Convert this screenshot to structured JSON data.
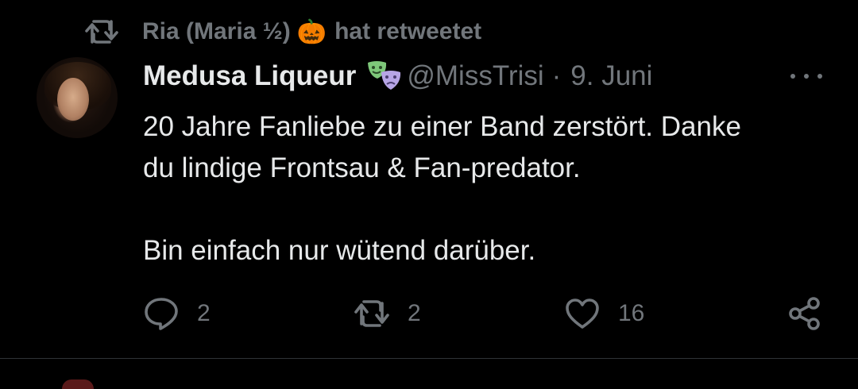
{
  "social_context": {
    "retweeter": "Ria (Maria ½)",
    "emoji": "🎃",
    "action": "hat retweetet"
  },
  "tweet": {
    "author_name": "Medusa Liqueur",
    "author_handle": "@MissTrisi",
    "separator": "·",
    "date": "9. Juni",
    "text": "20 Jahre Fanliebe zu einer Band zerstört. Danke\ndu lindige Frontsau & Fan-predator.\n\nBin einfach nur wütend darüber."
  },
  "actions": {
    "replies": "2",
    "retweets": "2",
    "likes": "16"
  },
  "icons": {
    "retweet": "retweet-icon",
    "masks": "performing-arts-masks-icon",
    "more": "more-dots-icon",
    "reply": "reply-bubble-icon",
    "like": "heart-icon",
    "share": "share-icon"
  },
  "colors": {
    "background": "#000000",
    "text_primary": "#e7e9ea",
    "text_secondary": "#71767b",
    "divider": "#2f3336"
  }
}
